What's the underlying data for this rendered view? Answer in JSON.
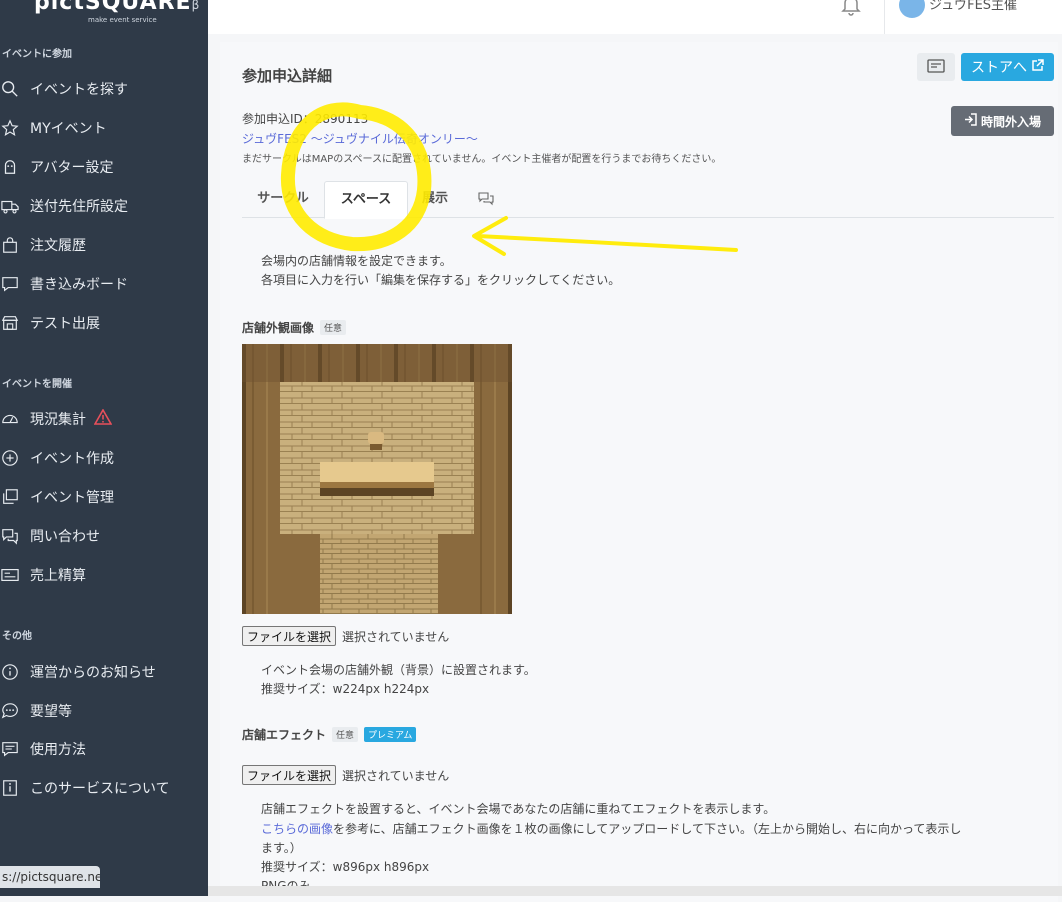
{
  "sidebar": {
    "logo": "pictSQUARE",
    "logo_suffix": "β",
    "tagline": "make event service",
    "sections": [
      {
        "title": "イベントに参加"
      },
      {
        "title": "イベントを開催"
      },
      {
        "title": "その他"
      }
    ],
    "items": [
      {
        "label": "イベントを探す",
        "icon": "search-icon"
      },
      {
        "label": "MYイベント",
        "icon": "star-icon"
      },
      {
        "label": "アバター設定",
        "icon": "avatar-icon"
      },
      {
        "label": "送付先住所設定",
        "icon": "truck-icon"
      },
      {
        "label": "注文履歴",
        "icon": "bag-icon"
      },
      {
        "label": "書き込みボード",
        "icon": "chat-icon"
      },
      {
        "label": "テスト出展",
        "icon": "store-icon"
      },
      {
        "label": "現況集計",
        "icon": "gauge-icon"
      },
      {
        "label": "イベント作成",
        "icon": "plus-circle-icon"
      },
      {
        "label": "イベント管理",
        "icon": "layers-icon"
      },
      {
        "label": "問い合わせ",
        "icon": "chat-bubbles-icon"
      },
      {
        "label": "売上精算",
        "icon": "receipt-icon"
      },
      {
        "label": "運営からのお知らせ",
        "icon": "info-icon"
      },
      {
        "label": "要望等",
        "icon": "speech-icon"
      },
      {
        "label": "使用方法",
        "icon": "list-icon"
      },
      {
        "label": "このサービスについて",
        "icon": "about-icon"
      }
    ],
    "url_tooltip": "s://pictsquare.net"
  },
  "header": {
    "user_name": "ジュヴFES主催"
  },
  "main": {
    "title": "参加申込詳細",
    "store_button": "ストアへ",
    "late_entry_button": "時間外入場",
    "entry_id": "参加申込ID：2890113",
    "event_name": "ジュヴFES2 ～ジュヴナイル伝奇オンリー～",
    "notice": "まだサークルはMAPのスペースに配置されていません。イベント主催者が配置を行うまでお待ちください。",
    "tabs": [
      {
        "label": "サークル"
      },
      {
        "label": "スペース",
        "active": true
      },
      {
        "label": "展示"
      },
      {
        "label": "",
        "icon": "comments-icon"
      }
    ],
    "intro_line1": "会場内の店舗情報を設定できます。",
    "intro_line2": "各項目に入力を行い「編集を保存する」をクリックしてください。",
    "exterior": {
      "label": "店舗外観画像",
      "badge": "任意",
      "file_button": "ファイルを選択",
      "file_status": "選択されていません",
      "desc1": "イベント会場の店舗外観（背景）に設置されます。",
      "desc2": "推奨サイズ：w224px h224px"
    },
    "effect": {
      "label": "店舗エフェクト",
      "badge": "任意",
      "premium_badge": "プレミアム",
      "file_button": "ファイルを選択",
      "file_status": "選択されていません",
      "desc1": "店舗エフェクトを設置すると、イベント会場であなたの店舗に重ねてエフェクトを表示します。",
      "desc2_link": "こちらの画像",
      "desc2_rest": "を参考に、店舗エフェクト画像を１枚の画像にしてアップロードして下さい。（左上から開始し、右に向かって表示し",
      "desc3": "ます。）",
      "desc4": "推奨サイズ：w896px h896px",
      "desc5": "PNGのみ"
    }
  },
  "colors": {
    "sidebar_bg": "#2f3a48",
    "accent": "#29a8e0",
    "link": "#5a6ad8",
    "annotation": "#ffeb00",
    "warning": "#e8505b"
  }
}
